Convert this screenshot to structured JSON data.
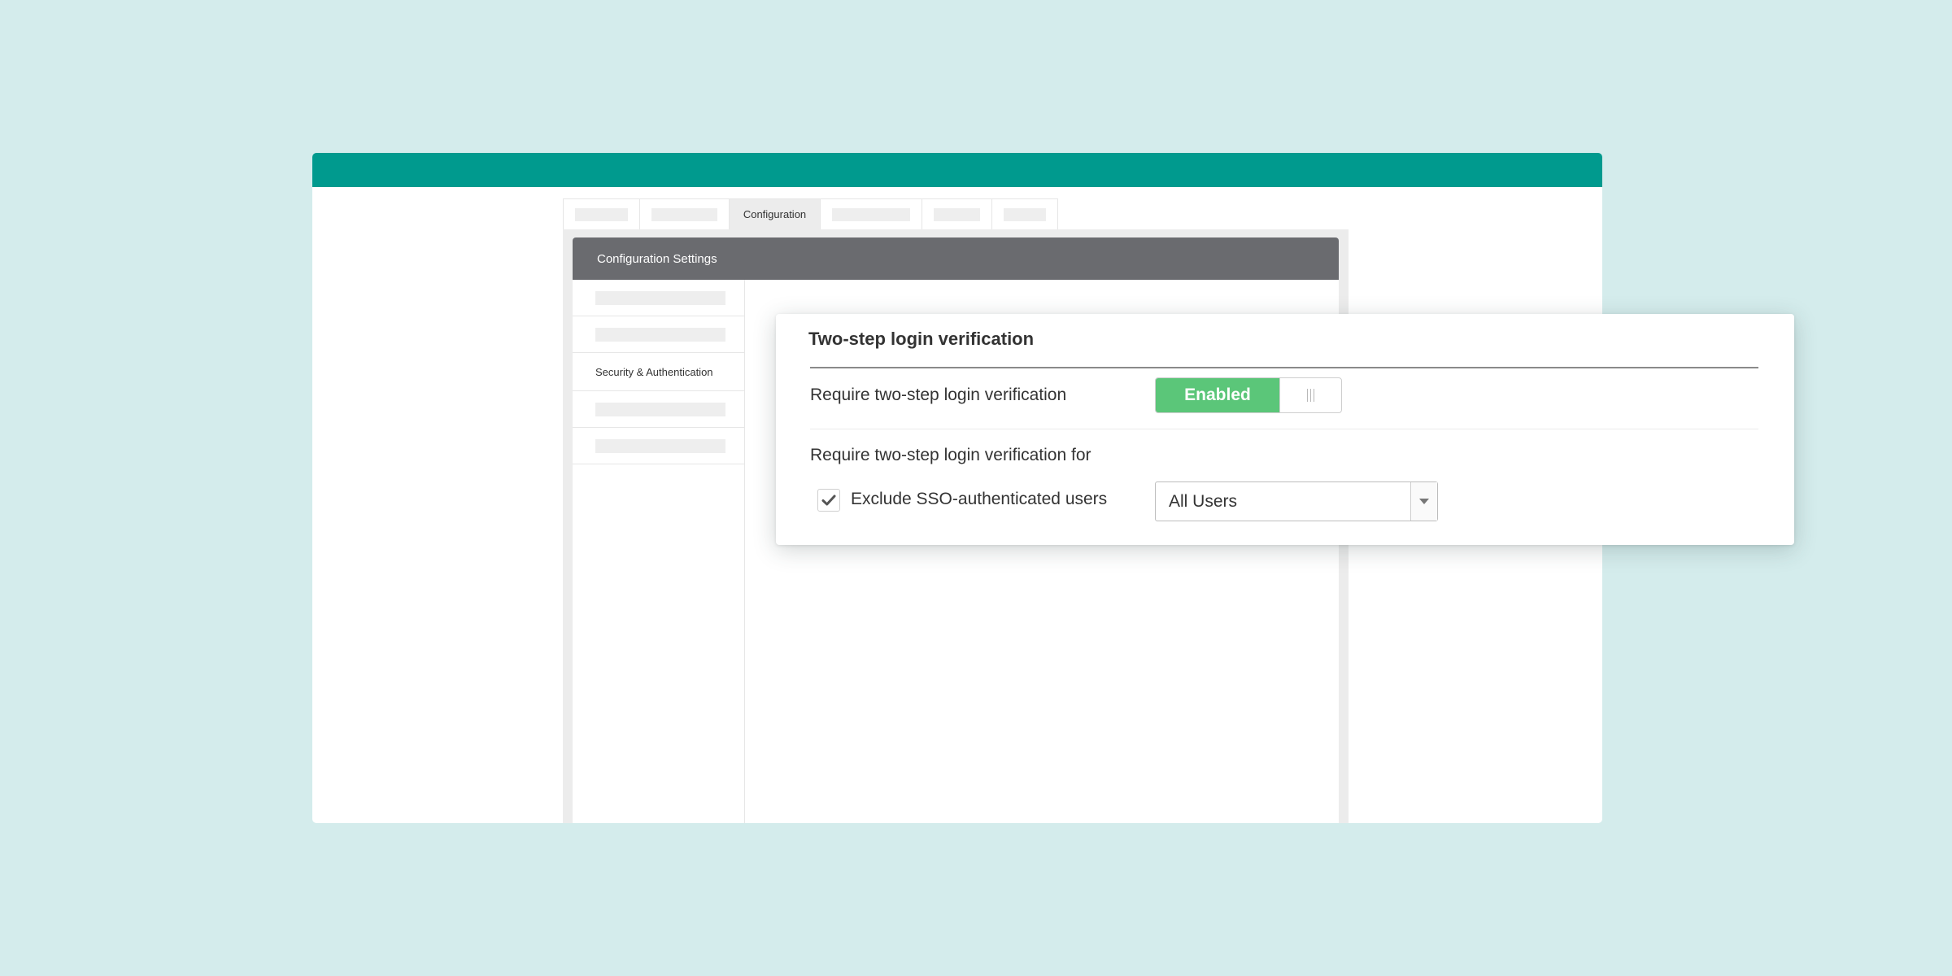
{
  "colors": {
    "page_background": "#d4ecec",
    "topbar": "#009a8e",
    "panel_header": "#6a6b6f",
    "toggle_on": "#5bc679"
  },
  "tabs": [
    {
      "label": "",
      "placeholder": true
    },
    {
      "label": "",
      "placeholder": true
    },
    {
      "label": "Configuration",
      "active": true
    },
    {
      "label": "",
      "placeholder": true
    },
    {
      "label": "",
      "placeholder": true
    },
    {
      "label": "",
      "placeholder": true
    }
  ],
  "config_panel": {
    "title": "Configuration Settings",
    "nav": [
      {
        "label": "",
        "placeholder": true
      },
      {
        "label": "",
        "placeholder": true
      },
      {
        "label": "Security & Authentication",
        "active": true
      },
      {
        "label": "",
        "placeholder": true
      },
      {
        "label": "",
        "placeholder": true
      }
    ]
  },
  "card": {
    "title": "Two-step login verification",
    "require_label": "Require two-step login verification",
    "toggle_state": "Enabled",
    "require_for_label": "Require two-step login verification for",
    "exclude_label": "Exclude SSO-authenticated users",
    "exclude_checked": true,
    "user_scope": "All Users",
    "icons": {
      "toggle_handle": "grip-icon",
      "checkbox": "check-icon",
      "select": "chevron-down-icon"
    }
  }
}
